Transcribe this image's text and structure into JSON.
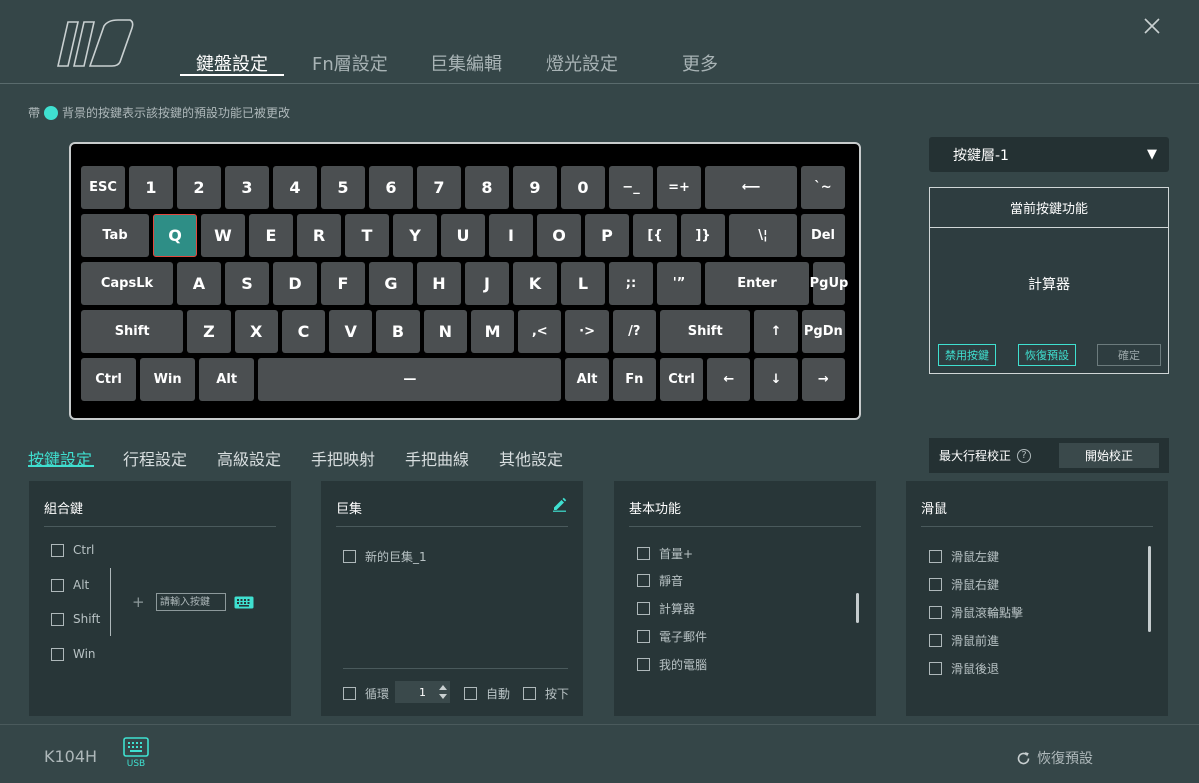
{
  "header": {
    "tabs": [
      {
        "label": "鍵盤設定"
      },
      {
        "label": "Fn層設定"
      },
      {
        "label": "巨集編輯"
      },
      {
        "label": "燈光設定"
      },
      {
        "label": "更多"
      }
    ],
    "active_tab": "鍵盤設定"
  },
  "legend": {
    "prefix": "帶",
    "text": "背景的按鍵表示該按鍵的預設功能已被更改"
  },
  "keyboard": {
    "selected_key": "Q",
    "rows": [
      [
        "ESC",
        "1",
        "2",
        "3",
        "4",
        "5",
        "6",
        "7",
        "8",
        "9",
        "0",
        "−_",
        "=+",
        "⟵",
        "`~"
      ],
      [
        "Tab",
        "Q",
        "W",
        "E",
        "R",
        "T",
        "Y",
        "U",
        "I",
        "O",
        "P",
        "[{",
        "]}",
        "\\¦",
        "Del"
      ],
      [
        "CapsLk",
        "A",
        "S",
        "D",
        "F",
        "G",
        "H",
        "J",
        "K",
        "L",
        ";:",
        "'”",
        "Enter",
        "PgUp"
      ],
      [
        "Shift",
        "Z",
        "X",
        "C",
        "V",
        "B",
        "N",
        "M",
        ",<",
        "·>",
        "/?",
        "Shift",
        "↑",
        "PgDn"
      ],
      [
        "Ctrl",
        "Win",
        "Alt",
        "—",
        "Alt",
        "Fn",
        "Ctrl",
        "←",
        "↓",
        "→"
      ]
    ]
  },
  "layer": {
    "selected": "按鍵層-1",
    "caret": "▼"
  },
  "current_function": {
    "title": "當前按鍵功能",
    "value": "計算器",
    "disable_label": "禁用按鍵",
    "restore_label": "恢復預設",
    "confirm_label": "確定"
  },
  "sub_tabs": [
    {
      "label": "按鍵設定"
    },
    {
      "label": "行程設定"
    },
    {
      "label": "高級設定"
    },
    {
      "label": "手把映射"
    },
    {
      "label": "手把曲線"
    },
    {
      "label": "其他設定"
    }
  ],
  "calibration": {
    "label": "最大行程校正",
    "help": "?",
    "button": "開始校正"
  },
  "panels": {
    "combo": {
      "title": "組合鍵",
      "modifiers": [
        "Ctrl",
        "Alt",
        "Shift",
        "Win"
      ],
      "plus": "+",
      "input_placeholder": "請輸入按鍵"
    },
    "macro": {
      "title": "巨集",
      "items": [
        "新的巨集_1"
      ],
      "loop_label": "循環",
      "loop_value": "1",
      "auto_label": "自動",
      "press_label": "按下"
    },
    "basic": {
      "title": "基本功能",
      "items": [
        "首量+",
        "靜音",
        "計算器",
        "電子郵件",
        "我的電腦"
      ]
    },
    "mouse": {
      "title": "滑鼠",
      "items": [
        "滑鼠左鍵",
        "滑鼠右鍵",
        "滑鼠滾輪點擊",
        "滑鼠前進",
        "滑鼠後退"
      ]
    }
  },
  "footer": {
    "device": "K104H",
    "connection": "USB",
    "restore_label": "恢復預設"
  }
}
